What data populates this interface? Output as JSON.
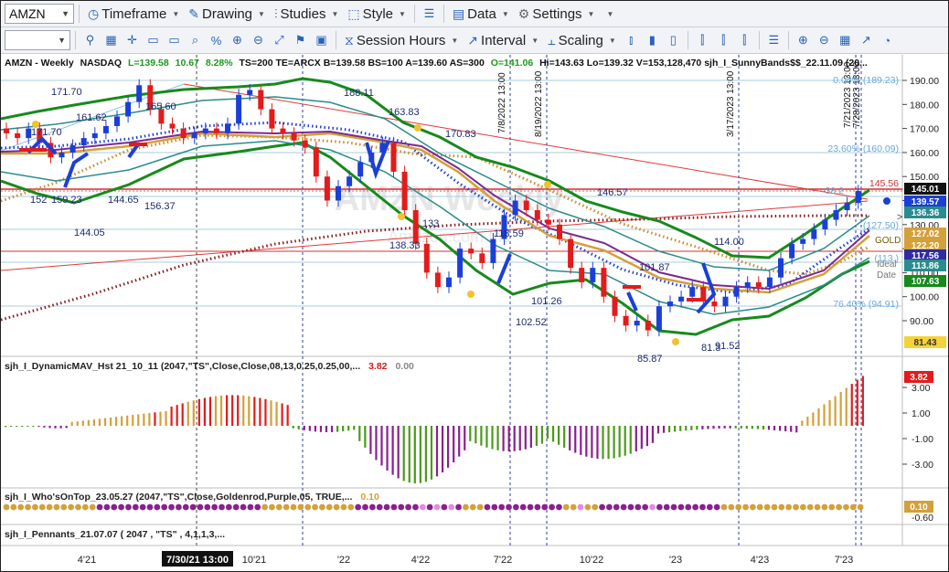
{
  "toolbar": {
    "symbol": "AMZN",
    "menus": {
      "timeframe": "Timeframe",
      "drawing": "Drawing",
      "studies": "Studies",
      "style": "Style",
      "data": "Data",
      "settings": "Settings"
    },
    "menus2": {
      "session": "Session Hours",
      "interval": "Interval",
      "scaling": "Scaling"
    }
  },
  "header": {
    "sym": "AMZN - Weekly",
    "exch": "NASDAQ",
    "last": "L=139.58",
    "chg": "10.67",
    "pct": "8.28%",
    "rest": "TS=200  TE=ARCX  B=139.58  BS=100  A=139.60  AS=300",
    "open": "O=141.06",
    "rest2": "Hi=143.63  Lo=139.32  V=153,128,470  sjh_I_SunnyBands$$_22.11.09 (20..."
  },
  "right_axis": {
    "ticks": [
      "190.00",
      "180.00",
      "170.00",
      "160.00",
      "150.00",
      "140.00",
      "130.00",
      "120.00",
      "110.00",
      "100.00",
      "90.00"
    ],
    "badges": {
      "b1": "145.01",
      "b2": "139.57",
      "b3": "136.36",
      "b4": "127.02",
      "b5": "122.20",
      "b6": "117.56",
      "b7": "113.86",
      "b8": "107.63",
      "b9": "81.43"
    },
    "line_145": "145.56",
    "text_gold": "GOLD",
    "text_ideal": "Ideal",
    "text_date": "Date",
    "text_arrow": ">"
  },
  "fib": {
    "f0": "0.00% (189.23)",
    "f236": "23.60% (160.09)",
    "f382": "38.2",
    "f50": "(127.50)",
    "f618": "(113.)",
    "f764": "76.40% (94.91)"
  },
  "price_labels": {
    "p171a": "171.70",
    "p171b": "171.70",
    "p165": "165.60",
    "p161": "161.62",
    "p159": "159.23",
    "p156": "156.37",
    "p144a": "144.05",
    "p144b": "144.65",
    "p152": "152",
    "p188": "188.11",
    "p163": "163.83",
    "p170": "170.83",
    "p133": "133",
    "p138": "138.33",
    "p114": "114.00",
    "p101a": "101.26",
    "p102": "102.52",
    "p101b": "101.87",
    "p85": "85.87",
    "p81": "81.3",
    "p91": "91.52",
    "p145": "146.57",
    "p118": "118.59"
  },
  "watermark": {
    "big": "AMZN Weekly",
    "sub": "Amazon.com Inc"
  },
  "vlabels": {
    "v1": "7/8/2022 13:00",
    "v2": "8/19/2022 13:00",
    "v3": "3/17/2023 13:00",
    "v4": "7/21/2023 13:00",
    "v5": "7/28/2023 13:00"
  },
  "ind1": {
    "title": "sjh_I_DynamicMAV_Hst 21_10_11 (2047,\"TS\",Close,Close,08,13,0.25,0.25,00,...",
    "v1": "3.82",
    "v2": "0.00",
    "badge": "3.82",
    "ticks": [
      "3.00",
      "1.00",
      "-1.00",
      "-3.00"
    ]
  },
  "ind2": {
    "title": "sjh_I_Who'sOnTop_23.05.27 (2047,\"TS\",Close,Goldenrod,Purple,05,  TRUE,...",
    "v1": "0.10",
    "badge": "0.10",
    "tick": "-0.60"
  },
  "ind3": {
    "title": "sjh_I_Pennants_21.07.07 ( 2047 , \"TS\" , 4,1,1,3,..."
  },
  "xaxis": {
    "t1": "4'21",
    "t2": "7/30/21 13:00",
    "t3": "10'21",
    "t4": "'22",
    "t5": "4'22",
    "t6": "7'22",
    "t7": "10'22",
    "t8": "'23",
    "t9": "4'23",
    "t10": "7'23"
  },
  "colors": {
    "up": "#1b3fd6",
    "down": "#e31b1b",
    "bandOuter": "#17891c",
    "bandInner": "#2c8c8c",
    "gold": "#d9a23a",
    "purple": "#7b2a8f"
  },
  "chart_data": {
    "type": "candlestick",
    "series": [
      {
        "values": [
          168,
          166,
          170,
          164,
          158,
          160,
          163,
          166,
          168,
          171,
          175,
          181,
          188,
          178,
          172,
          170,
          166,
          168,
          170,
          168,
          172,
          184,
          186,
          178,
          170,
          168,
          165,
          162,
          150,
          140,
          146,
          150,
          156,
          160,
          164,
          152,
          136,
          122,
          110,
          104,
          108,
          120,
          118,
          114,
          124,
          134,
          140,
          136,
          132,
          130,
          124,
          112,
          106,
          112,
          100,
          92,
          88,
          90,
          86,
          96,
          98,
          100,
          104,
          98,
          96,
          100,
          104,
          106,
          104,
          108,
          116,
          122,
          124,
          128,
          132,
          136,
          139,
          144
        ]
      }
    ]
  }
}
